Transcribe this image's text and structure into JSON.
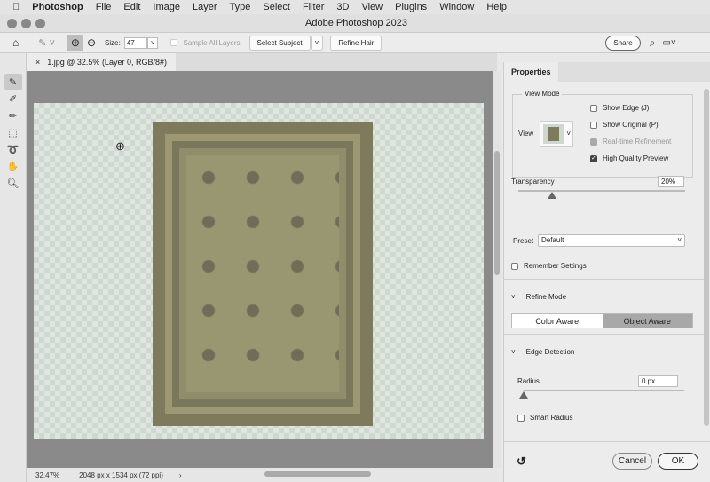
{
  "menubar": {
    "app": "Photoshop",
    "items": [
      "File",
      "Edit",
      "Image",
      "Layer",
      "Type",
      "Select",
      "Filter",
      "3D",
      "View",
      "Plugins",
      "Window",
      "Help"
    ]
  },
  "window": {
    "title": "Adobe Photoshop 2023"
  },
  "options": {
    "size_label": "Size:",
    "size_value": "47",
    "sample_all_layers": "Sample All Layers",
    "select_subject": "Select Subject",
    "refine_hair": "Refine Hair",
    "share": "Share"
  },
  "document": {
    "tab_label": "1.jpg @ 32.5% (Layer 0, RGB/8#)",
    "zoom": "32.47%",
    "info": "2048 px x 1534 px (72 ppi)"
  },
  "properties": {
    "tab": "Properties",
    "view_mode": "View Mode",
    "view_label": "View",
    "show_edge": "Show Edge (J)",
    "show_original": "Show Original (P)",
    "realtime": "Real-time Refinement",
    "hq_preview": "High Quality Preview",
    "transparency_label": "Transparency",
    "transparency_value": "20%",
    "transparency_fraction": 0.2,
    "preset_label": "Preset",
    "preset_value": "Default",
    "remember": "Remember Settings",
    "refine_mode": "Refine Mode",
    "color_aware": "Color Aware",
    "object_aware": "Object Aware",
    "edge_detection": "Edge Detection",
    "radius_label": "Radius",
    "radius_value": "0 px",
    "smart_radius": "Smart Radius",
    "cancel": "Cancel",
    "ok": "OK"
  }
}
